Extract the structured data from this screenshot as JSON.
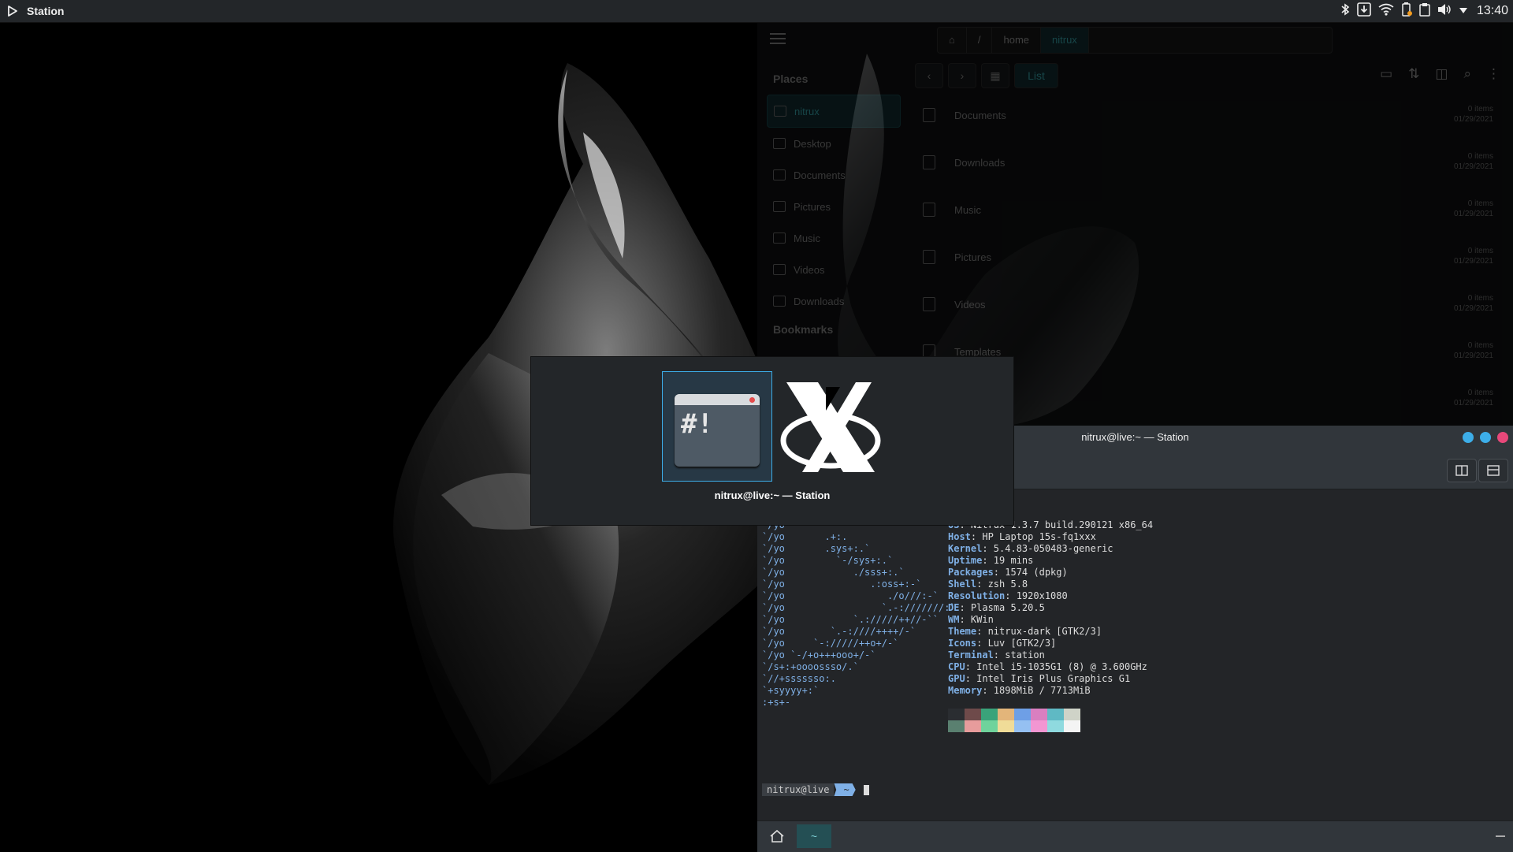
{
  "top_panel": {
    "app_title": "Station",
    "clock": "13:40"
  },
  "file_manager": {
    "path": [
      "/",
      "home",
      "nitrux"
    ],
    "view_label": "List",
    "places_title": "Places",
    "places": [
      "nitrux",
      "Desktop",
      "Documents",
      "Pictures",
      "Music",
      "Videos",
      "Downloads"
    ],
    "bookmarks_title": "Bookmarks",
    "files": [
      {
        "name": "Documents",
        "meta1": "0 items",
        "meta2": "01/29/2021"
      },
      {
        "name": "Downloads",
        "meta1": "0 items",
        "meta2": "01/29/2021"
      },
      {
        "name": "Music",
        "meta1": "0 items",
        "meta2": "01/29/2021"
      },
      {
        "name": "Pictures",
        "meta1": "0 items",
        "meta2": "01/29/2021"
      },
      {
        "name": "Videos",
        "meta1": "0 items",
        "meta2": "01/29/2021"
      },
      {
        "name": "Templates",
        "meta1": "0 items",
        "meta2": "01/29/2021"
      },
      {
        "name": "",
        "meta1": "0 items",
        "meta2": "01/29/2021"
      }
    ]
  },
  "terminal": {
    "title": "nitrux@live:~ — Station",
    "logo": "`/yo\n`/yo       .+:.\n`/yo       .sys+:.`\n`/yo         `-/sys+:.`\n`/yo            ./sss+:.`\n`/yo               .:oss+:-`\n`/yo                  ./o///:-`\n`/yo                 `.-:///////:`\n`/yo            `.://///++//-``\n`/yo        `.-:////++++/-`\n`/yo     `-://///++o+/-`\n`/yo `-/+o+++ooo+/-`\n`/s+:+oooossso/.`\n`//+sssssso:.\n`+syyyy+:`\n:+s+-",
    "info": [
      {
        "key": "OS",
        "value": ": Nitrux 1.3.7 build.290121 x86_64"
      },
      {
        "key": "Host",
        "value": ": HP Laptop 15s-fq1xxx"
      },
      {
        "key": "Kernel",
        "value": ": 5.4.83-050483-generic"
      },
      {
        "key": "Uptime",
        "value": ": 19 mins"
      },
      {
        "key": "Packages",
        "value": ": 1574 (dpkg)"
      },
      {
        "key": "Shell",
        "value": ": zsh 5.8"
      },
      {
        "key": "Resolution",
        "value": ": 1920x1080"
      },
      {
        "key": "DE",
        "value": ": Plasma 5.20.5"
      },
      {
        "key": "WM",
        "value": ": KWin"
      },
      {
        "key": "Theme",
        "value": ": nitrux-dark [GTK2/3]"
      },
      {
        "key": "Icons",
        "value": ": Luv [GTK2/3]"
      },
      {
        "key": "Terminal",
        "value": ": station"
      },
      {
        "key": "CPU",
        "value": ": Intel i5-1035G1 (8) @ 3.600GHz"
      },
      {
        "key": "GPU",
        "value": ": Intel Iris Plus Graphics G1"
      },
      {
        "key": "Memory",
        "value": ": 1898MiB / 7713MiB"
      }
    ],
    "palette": [
      "#2a2d31",
      "#6e4a4a",
      "#3aa37a",
      "#e3b57a",
      "#6e9fe6",
      "#d97fc0",
      "#5fb9c4",
      "#cfd3c8",
      "#5a8070",
      "#e79c9c",
      "#6fd39c",
      "#f0dc98",
      "#95c0f2",
      "#f296d2",
      "#8fdadf",
      "#f4f4f4"
    ],
    "prompt_user": "nitrux@live",
    "prompt_dir": "~",
    "tab_label": "~"
  },
  "switcher": {
    "label": "nitrux@live:~ — Station"
  }
}
